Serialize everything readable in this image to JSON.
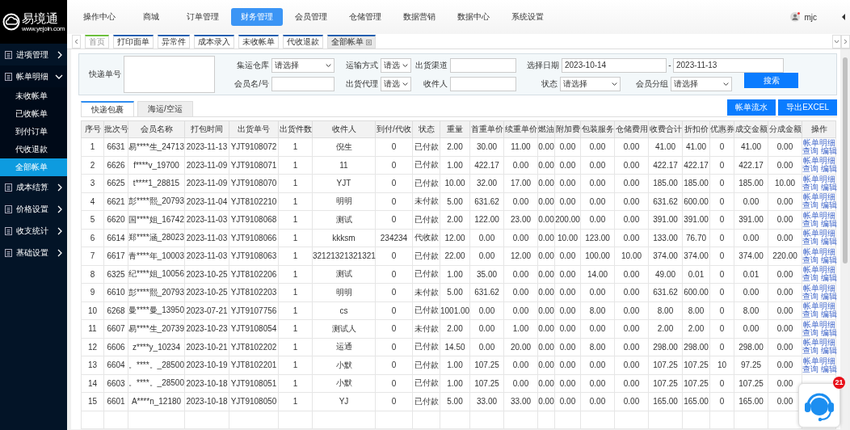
{
  "logo": {
    "name": "易境通",
    "url": "www.yejoin.com"
  },
  "nav": [
    {
      "label": "操作中心",
      "selected": false
    },
    {
      "label": "商城",
      "selected": false
    },
    {
      "label": "订单管理",
      "selected": false
    },
    {
      "label": "财务管理",
      "selected": true
    },
    {
      "label": "会员管理",
      "selected": false
    },
    {
      "label": "仓储管理",
      "selected": false
    },
    {
      "label": "数据营销",
      "selected": false
    },
    {
      "label": "数据中心",
      "selected": false
    },
    {
      "label": "系统设置",
      "selected": false
    }
  ],
  "user": {
    "name": "mjc"
  },
  "sidebar": [
    {
      "label": "进项管理",
      "expanded": false
    },
    {
      "label": "帐单明细",
      "expanded": true,
      "children": [
        {
          "label": "未收帐单",
          "selected": false
        },
        {
          "label": "已收帐单",
          "selected": false
        },
        {
          "label": "到付订单",
          "selected": false
        },
        {
          "label": "代收退款",
          "selected": false
        },
        {
          "label": "全部帐单",
          "selected": true
        }
      ]
    },
    {
      "label": "成本结算",
      "expanded": false
    },
    {
      "label": "价格设置",
      "expanded": false
    },
    {
      "label": "收支统计",
      "expanded": false
    },
    {
      "label": "基础设置",
      "expanded": false
    }
  ],
  "open_tabs": [
    {
      "label": "首页",
      "kind": "home",
      "selected": false
    },
    {
      "label": "打印面单",
      "kind": "page",
      "selected": false
    },
    {
      "label": "异常件",
      "kind": "page",
      "selected": false
    },
    {
      "label": "成本录入",
      "kind": "page",
      "selected": false
    },
    {
      "label": "未收帐单",
      "kind": "page",
      "selected": false
    },
    {
      "label": "代收退款",
      "kind": "page",
      "selected": false
    },
    {
      "label": "全部帐单",
      "kind": "page",
      "selected": true
    }
  ],
  "filters": [
    {
      "kind": "textarea",
      "label": "快递单号"
    },
    {
      "kind": "select",
      "label": "集运仓库",
      "value": "请选择"
    },
    {
      "kind": "select",
      "label": "运输方式",
      "value": "请选"
    },
    {
      "kind": "input",
      "label": "出货渠道"
    },
    {
      "kind": "daterange",
      "label": "选择日期",
      "from": "2023-10-14",
      "separator": "-",
      "to": "2023-11-13"
    },
    {
      "kind": "input",
      "label": "会员名/号"
    },
    {
      "kind": "select",
      "label": "出货代理",
      "value": "请选"
    },
    {
      "kind": "input",
      "label": "收件人"
    },
    {
      "kind": "select",
      "label": "状态",
      "value": "请选择"
    },
    {
      "kind": "select",
      "label": "会员分组",
      "value": "请选择"
    }
  ],
  "search_button": "搜索",
  "subtabs": [
    {
      "label": "快递包裹",
      "selected": true
    },
    {
      "label": "海运/空运",
      "selected": false
    }
  ],
  "action_buttons": [
    "帐单流水",
    "导出EXCEL"
  ],
  "table": {
    "columns": [
      "序号",
      "批次号",
      "会员名称",
      "打包时间",
      "出货单号",
      "出货件数",
      "收件人",
      "到付/代收",
      "状态",
      "重量",
      "首重单价",
      "续重单价",
      "燃油",
      "附加费",
      "包装服务",
      "仓储费用",
      "收费合计",
      "折扣价",
      "优惠券",
      "成交金额",
      "分成金额",
      "操作"
    ],
    "rows": [
      {
        "cells": [
          "1",
          "6631",
          "易****生_24713",
          "2023-11-13",
          "YJT9108072",
          "1",
          "倪生",
          "0",
          "已付款",
          "2.00",
          "30.00",
          "11.00",
          "0.00",
          "0.00",
          "0.00",
          "0.00",
          "41.00",
          "41.00",
          "0",
          "41.00",
          "0.00"
        ],
        "actions": [
          "帐单明细",
          "查询",
          "编辑"
        ]
      },
      {
        "cells": [
          "2",
          "6626",
          "f****v_19700",
          "2023-11-09",
          "YJT9108071",
          "1",
          "11",
          "0",
          "已付款",
          "1.00",
          "422.17",
          "0.00",
          "0.00",
          "0.00",
          "0.00",
          "0.00",
          "422.17",
          "422.17",
          "0",
          "422.17",
          "0.00"
        ],
        "actions": [
          "帐单明细",
          "查询",
          "编辑"
        ]
      },
      {
        "cells": [
          "3",
          "6625",
          "t****1_28815",
          "2023-11-09",
          "YJT9108070",
          "1",
          "YJT",
          "0",
          "已付款",
          "10.00",
          "32.00",
          "17.00",
          "0.00",
          "0.00",
          "0.00",
          "0.00",
          "185.00",
          "185.00",
          "0",
          "185.00",
          "10.00"
        ],
        "actions": [
          "帐单明细",
          "查询",
          "编辑"
        ]
      },
      {
        "cells": [
          "4",
          "6621",
          "彭****熙_20793",
          "2023-11-04",
          "YJT8102210",
          "1",
          "明明",
          "0",
          "未付款",
          "5.00",
          "631.62",
          "0.00",
          "0.00",
          "0.00",
          "0.00",
          "0.00",
          "631.62",
          "600.00",
          "0",
          "0.00",
          "0.00"
        ],
        "actions": [
          "帐单明细",
          "查询",
          "编辑"
        ]
      },
      {
        "cells": [
          "5",
          "6620",
          "国****姐_16742",
          "2023-11-03",
          "YJT9108068",
          "1",
          "测试",
          "0",
          "已付款",
          "2.00",
          "122.00",
          "23.00",
          "0.00",
          "200.00",
          "0.00",
          "0.00",
          "391.00",
          "391.00",
          "0",
          "391.00",
          "0.00"
        ],
        "actions": [
          "帐单明细",
          "查询",
          "编辑"
        ]
      },
      {
        "cells": [
          "6",
          "6614",
          "郑****涵_28023",
          "2023-11-03",
          "YJT9108066",
          "1",
          "kkksm",
          "234234",
          "代收款",
          "12.00",
          "0.00",
          "0.00",
          "0.00",
          "10.00",
          "123.00",
          "0.00",
          "133.00",
          "76.70",
          "0",
          "0.00",
          "0.00"
        ],
        "actions": [
          "帐单明细",
          "查询",
          "编辑"
        ]
      },
      {
        "cells": [
          "7",
          "6617",
          "青****年_10003",
          "2023-11-03",
          "YJT9108063",
          "1",
          "32121321321321",
          "0",
          "已付款",
          "22.00",
          "0.00",
          "12.00",
          "0.00",
          "0.00",
          "100.00",
          "10.00",
          "374.00",
          "374.00",
          "0",
          "374.00",
          "220.00"
        ],
        "actions": [
          "帐单明细",
          "查询",
          "编辑"
        ]
      },
      {
        "cells": [
          "8",
          "6325",
          "纪****姐_10056",
          "2023-10-25",
          "YJT8102206",
          "1",
          "测试",
          "0",
          "已付款",
          "1.00",
          "35.00",
          "0.00",
          "0.00",
          "0.00",
          "14.00",
          "0.00",
          "49.00",
          "0.01",
          "0",
          "0.01",
          "0.00"
        ],
        "actions": [
          "帐单明细",
          "查询",
          "编辑"
        ]
      },
      {
        "cells": [
          "9",
          "6610",
          "彭****熙_20793",
          "2023-10-25",
          "YJT8102203",
          "1",
          "明明",
          "0",
          "未付款",
          "5.00",
          "631.62",
          "0.00",
          "0.00",
          "0.00",
          "0.00",
          "0.00",
          "631.62",
          "600.00",
          "0",
          "0.00",
          "0.00"
        ],
        "actions": [
          "帐单明细",
          "查询",
          "编辑"
        ]
      },
      {
        "cells": [
          "10",
          "6268",
          "曼****曼_13950",
          "2023-07-21",
          "YJT9107756",
          "1",
          "cs",
          "0",
          "已付款",
          "1001.00",
          "0.00",
          "0.00",
          "0.00",
          "0.00",
          "8.00",
          "0.00",
          "8.00",
          "8.00",
          "0",
          "8.00",
          "0.00"
        ],
        "actions": [
          "帐单明细",
          "查询",
          "编辑"
        ]
      },
      {
        "cells": [
          "11",
          "6607",
          "易****生_20739",
          "2023-10-23",
          "YJT9108054",
          "1",
          "测试人",
          "0",
          "未付款",
          "2.00",
          "0.00",
          "1.00",
          "0.00",
          "0.00",
          "0.00",
          "0.00",
          "2.00",
          "2.00",
          "0",
          "0.00",
          "0.00"
        ],
        "actions": [
          "帐单明细",
          "查询",
          "编辑"
        ]
      },
      {
        "cells": [
          "12",
          "6606",
          "z****y_10234",
          "2023-10-21",
          "YJT8102202",
          "1",
          "运通",
          "0",
          "已付款",
          "14.50",
          "0.00",
          "20.00",
          "0.00",
          "0.00",
          "8.00",
          "0.00",
          "298.00",
          "298.00",
          "0",
          "298.00",
          "0.00"
        ],
        "actions": [
          "帐单明细",
          "查询",
          "编辑"
        ]
      },
      {
        "cells": [
          "13",
          "6604",
          "。****。_28500",
          "2023-10-19",
          "YJT8102201",
          "1",
          "小默",
          "0",
          "已付款",
          "1.00",
          "107.25",
          "0.00",
          "0.00",
          "0.00",
          "0.00",
          "0.00",
          "107.25",
          "107.25",
          "10",
          "97.25",
          "0.00"
        ],
        "actions": [
          "帐单明细",
          "查询",
          "编辑"
        ]
      },
      {
        "cells": [
          "14",
          "6603",
          "。****。_28500",
          "2023-10-18",
          "YJT9108051",
          "1",
          "小默",
          "0",
          "已付款",
          "1.00",
          "107.25",
          "0.00",
          "0.00",
          "0.00",
          "0.00",
          "0.00",
          "107.25",
          "107.25",
          "0",
          "107.25",
          "0.00"
        ]
      },
      {
        "cells": [
          "15",
          "6601",
          "A****n_12180",
          "2023-10-18",
          "YJT9108050",
          "1",
          "YJ",
          "0",
          "已付款",
          "5.00",
          "33.00",
          "33.00",
          "0.00",
          "0.00",
          "0.00",
          "0.00",
          "165.00",
          "165.00",
          "0",
          "165.00",
          "0.00"
        ]
      }
    ]
  },
  "chat": {
    "badge": "21"
  }
}
